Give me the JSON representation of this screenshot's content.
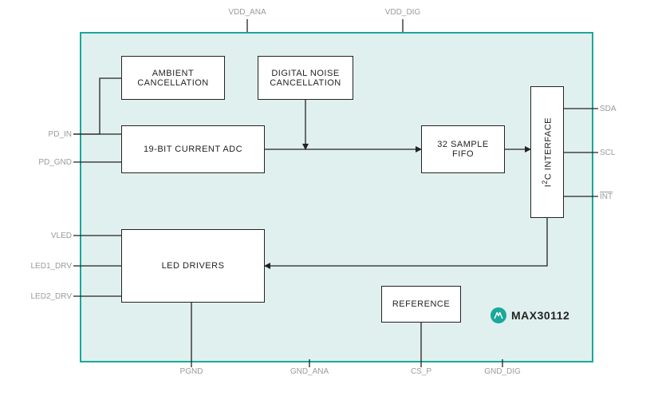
{
  "part_number": "MAX30112",
  "blocks": {
    "ambient": "AMBIENT CANCELLATION",
    "dnc": "DIGITAL NOISE CANCELLATION",
    "adc": "19-BIT CURRENT ADC",
    "fifo": "32 SAMPLE FIFO",
    "i2c_line1": "I",
    "i2c_line2": "2",
    "i2c_line3": "C INTERFACE",
    "led": "LED DRIVERS",
    "ref": "REFERENCE"
  },
  "pins": {
    "vdd_ana": "VDD_ANA",
    "vdd_dig": "VDD_DIG",
    "pd_in": "PD_IN",
    "pd_gnd": "PD_GND",
    "vled": "VLED",
    "led1_drv": "LED1_DRV",
    "led2_drv": "LED2_DRV",
    "sda": "SDA",
    "scl": "SCL",
    "int_": "INT",
    "pgnd": "PGND",
    "gnd_ana": "GND_ANA",
    "cs_p": "CS_P",
    "gnd_dig": "GND_DIG"
  }
}
